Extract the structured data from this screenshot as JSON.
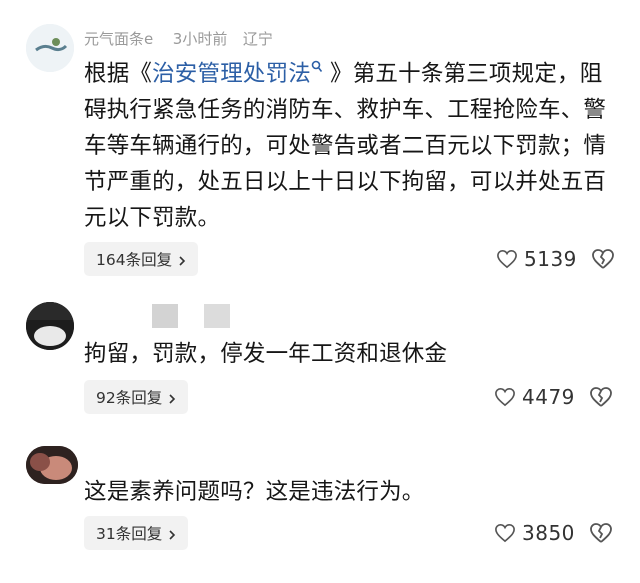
{
  "comments": [
    {
      "meta_name": "元气面条e",
      "meta_time": "3小时前",
      "meta_location": "辽宁",
      "text_prefix": "根据《",
      "text_link": "治安管理处罚法",
      "text_rest": "》第五十条第三项规定，阻碍执行紧急任务的消防车、救护车、工程抢险车、警车等车辆通行的，可处警告或者二百元以下罚款；情节严重的，处五日以上十日以下拘留，可以并处五百元以下罚款。",
      "reply_label": "164条回复",
      "likes": "5139"
    },
    {
      "text": "拘留，罚款，停发一年工资和退休金",
      "reply_label": "92条回复",
      "likes": "4479"
    },
    {
      "text": "这是素养问题吗？这是违法行为。",
      "reply_label": "31条回复",
      "likes": "3850"
    }
  ],
  "icons": {
    "like": "heart-icon",
    "dislike": "broken-heart-icon",
    "reply_arrow": "chevron-right-icon",
    "search": "search-icon"
  },
  "colors": {
    "link": "#2c5fa6",
    "reply_bg": "#f2f2f2",
    "meta": "#9a9a9a"
  }
}
